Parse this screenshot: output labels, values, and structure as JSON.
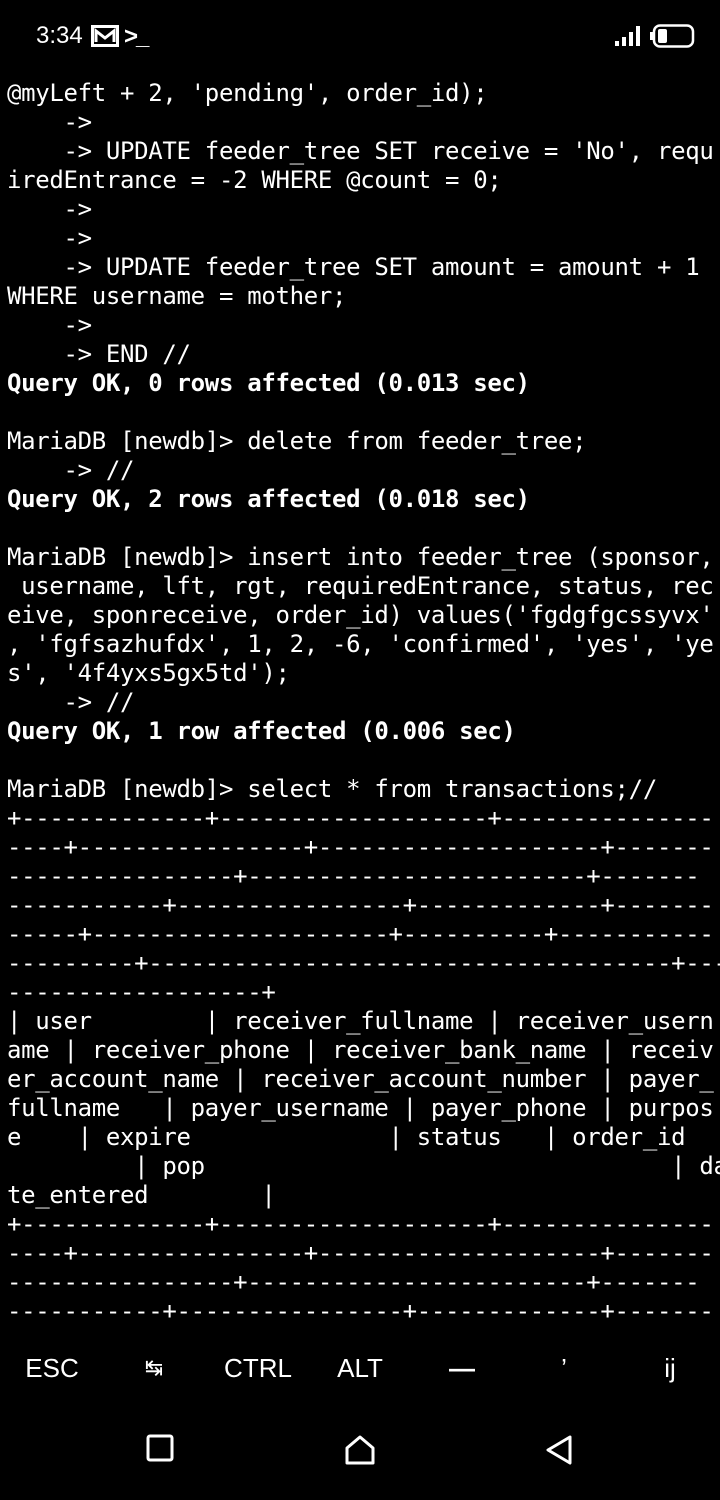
{
  "status_bar": {
    "time": "3:34",
    "prompt_glyph": ">_"
  },
  "terminal": {
    "lines": [
      {
        "text": "@myLeft + 2, 'pending', order_id);",
        "bold": false
      },
      {
        "text": "    ->",
        "bold": false
      },
      {
        "text": "    -> UPDATE feeder_tree SET receive = 'No', requ",
        "bold": false
      },
      {
        "text": "iredEntrance = -2 WHERE @count = 0;",
        "bold": false
      },
      {
        "text": "    ->",
        "bold": false
      },
      {
        "text": "    ->",
        "bold": false
      },
      {
        "text": "    -> UPDATE feeder_tree SET amount = amount + 1",
        "bold": false
      },
      {
        "text": "WHERE username = mother;",
        "bold": false
      },
      {
        "text": "    ->",
        "bold": false
      },
      {
        "text": "    -> END //",
        "bold": false
      },
      {
        "text": "Query OK, 0 rows affected (0.013 sec)",
        "bold": true
      },
      {
        "text": "",
        "bold": false
      },
      {
        "text": "MariaDB [newdb]> delete from feeder_tree;",
        "bold": false
      },
      {
        "text": "    -> //",
        "bold": false
      },
      {
        "text": "Query OK, 2 rows affected (0.018 sec)",
        "bold": true
      },
      {
        "text": "",
        "bold": false
      },
      {
        "text": "MariaDB [newdb]> insert into feeder_tree (sponsor,",
        "bold": false
      },
      {
        "text": " username, lft, rgt, requiredEntrance, status, rec",
        "bold": false
      },
      {
        "text": "eive, sponreceive, order_id) values('fgdgfgcssyvx'",
        "bold": false
      },
      {
        "text": ", 'fgfsazhufdx', 1, 2, -6, 'confirmed', 'yes', 'ye",
        "bold": false
      },
      {
        "text": "s', '4f4yxs5gx5td');",
        "bold": false
      },
      {
        "text": "    -> //",
        "bold": false
      },
      {
        "text": "Query OK, 1 row affected (0.006 sec)",
        "bold": true
      },
      {
        "text": "",
        "bold": false
      },
      {
        "text": "MariaDB [newdb]> select * from transactions;//",
        "bold": false
      },
      {
        "text": "+-------------+-------------------+---------------",
        "bold": false
      },
      {
        "text": "----+----------------+--------------------+-------",
        "bold": false
      },
      {
        "text": "----------------+------------------------+-------",
        "bold": false
      },
      {
        "text": "-----------+----------------+-------------+-------",
        "bold": false
      },
      {
        "text": "-----+---------------------+----------+-----------",
        "bold": false
      },
      {
        "text": "---------+-------------------------------------+---",
        "bold": false
      },
      {
        "text": "------------------+",
        "bold": false
      },
      {
        "text": "| user        | receiver_fullname | receiver_usern",
        "bold": false
      },
      {
        "text": "ame | receiver_phone | receiver_bank_name | receiv",
        "bold": false
      },
      {
        "text": "er_account_name | receiver_account_number | payer_",
        "bold": false
      },
      {
        "text": "fullname   | payer_username | payer_phone | purpos",
        "bold": false
      },
      {
        "text": "e    | expire              | status   | order_id",
        "bold": false
      },
      {
        "text": "         | pop                                 | da",
        "bold": false
      },
      {
        "text": "te_entered        |",
        "bold": false
      },
      {
        "text": "+-------------+-------------------+---------------",
        "bold": false
      },
      {
        "text": "----+----------------+--------------------+-------",
        "bold": false
      },
      {
        "text": "----------------+------------------------+-------",
        "bold": false
      },
      {
        "text": "-----------+----------------+-------------+-------",
        "bold": false
      }
    ]
  },
  "extra_keys": {
    "esc": "ESC",
    "tab": "↹",
    "ctrl": "CTRL",
    "alt": "ALT",
    "dash": "—",
    "apostrophe": "’",
    "ij": "ij"
  },
  "colors": {
    "background": "#000000",
    "text": "#ffffff"
  }
}
